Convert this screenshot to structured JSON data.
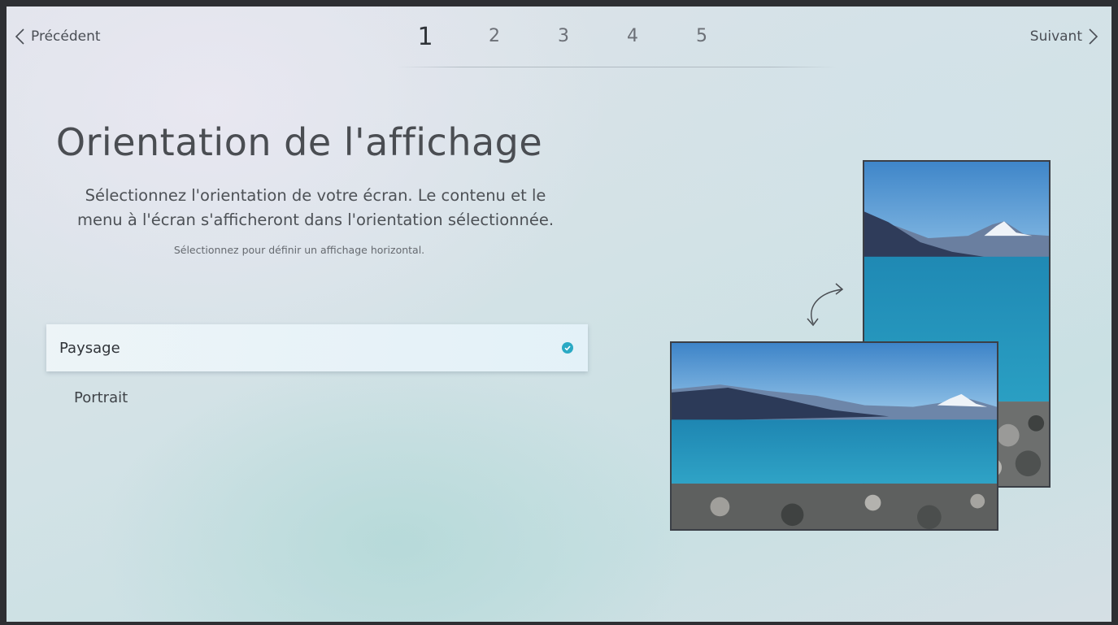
{
  "nav": {
    "prev_label": "Précédent",
    "next_label": "Suivant"
  },
  "steps": [
    "1",
    "2",
    "3",
    "4",
    "5"
  ],
  "active_step": 1,
  "content": {
    "title": "Orientation de l'affichage",
    "description_line1": "Sélectionnez l'orientation de votre écran. Le contenu et le",
    "description_line2": "menu à l'écran s'afficheront dans l'orientation sélectionnée.",
    "hint": "Sélectionnez pour définir un affichage horizontal."
  },
  "options": [
    {
      "label": "Paysage",
      "selected": true
    },
    {
      "label": "Portrait",
      "selected": false
    }
  ],
  "colors": {
    "accent": "#2aa9c4",
    "text_primary": "#2f3338"
  },
  "icons": [
    "chevron-left-icon",
    "chevron-right-icon",
    "checkmark-icon",
    "rotate-arrow-icon"
  ]
}
